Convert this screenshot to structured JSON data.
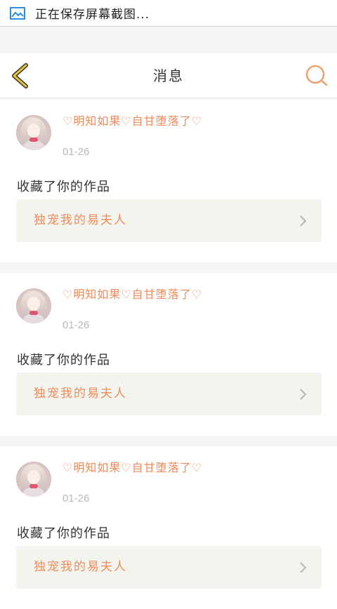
{
  "status_bar": {
    "icon": "screenshot-gallery-icon",
    "text": "正在保存屏幕截图..."
  },
  "header": {
    "title": "消息",
    "back_icon": "chevron-left-icon",
    "search_icon": "search-icon"
  },
  "colors": {
    "accent": "#f08a5a",
    "back_icon": "#e6c43a",
    "background": "#f5f5f7",
    "link_bg": "#f4f4ee"
  },
  "messages": [
    {
      "username": "♡明知如果♡自甘堕落了♡",
      "date": "01-26",
      "action": "收藏了你的作品",
      "work_title": "独宠我的易夫人"
    },
    {
      "username": "♡明知如果♡自甘堕落了♡",
      "date": "01-26",
      "action": "收藏了你的作品",
      "work_title": "独宠我的易夫人"
    },
    {
      "username": "♡明知如果♡自甘堕落了♡",
      "date": "01-26",
      "action": "收藏了你的作品",
      "work_title": "独宠我的易夫人"
    }
  ]
}
